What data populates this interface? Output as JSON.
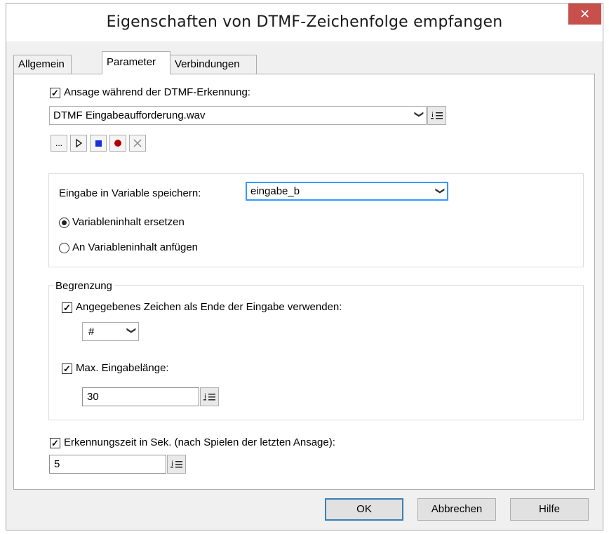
{
  "window": {
    "title": "Eigenschaften von DTMF-Zeichenfolge empfangen",
    "close_glyph": "✕"
  },
  "tabs": [
    {
      "label": "Allgemein",
      "active": false
    },
    {
      "label": "Parameter",
      "active": true
    },
    {
      "label": "Verbindungen",
      "active": false
    }
  ],
  "announcement": {
    "checkbox_label": "Ansage während der DTMF-Erkennung:",
    "checked": true,
    "file": "DTMF Eingabeaufforderung.wav",
    "buttons": [
      {
        "name": "browse",
        "glyph": "..."
      },
      {
        "name": "play",
        "icon": "play-icon"
      },
      {
        "name": "stop",
        "icon": "stop-icon"
      },
      {
        "name": "record",
        "icon": "record-icon"
      },
      {
        "name": "delete",
        "icon": "delete-icon"
      }
    ]
  },
  "variable": {
    "label": "Eingabe in Variable speichern:",
    "value": "eingabe_b",
    "options": [
      {
        "label": "Variableninhalt ersetzen",
        "selected": true
      },
      {
        "label": "An Variableninhalt anfügen",
        "selected": false
      }
    ]
  },
  "limit": {
    "group_title": "Begrenzung",
    "end_char_label": "Angegebenes Zeichen als Ende der Eingabe verwenden:",
    "end_char_checked": true,
    "end_char_value": "#",
    "max_len_label": "Max. Eingabelänge:",
    "max_len_checked": true,
    "max_len_value": "30"
  },
  "timeout": {
    "label": "Erkennungszeit in Sek. (nach Spielen der letzten Ansage):",
    "checked": true,
    "value": "5"
  },
  "footer": {
    "ok": "OK",
    "cancel": "Abbrechen",
    "help": "Hilfe"
  },
  "check_glyph": "✓",
  "chevron_glyph": "❯",
  "colors": {
    "close_bg": "#c7504c",
    "record": "#b00000",
    "stop": "#1a2fd6",
    "focus": "#3399ff"
  }
}
